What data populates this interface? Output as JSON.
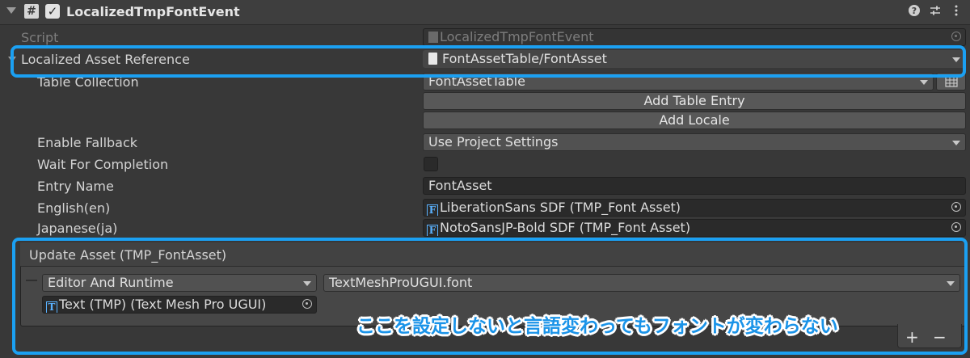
{
  "component": {
    "title": "LocalizedTmpFontEvent",
    "help_icon": "help-icon",
    "settings_icon": "sliders-icon",
    "menu_icon": "kebab-menu-icon"
  },
  "script_row": {
    "label": "Script",
    "value": "LocalizedTmpFontEvent"
  },
  "asset_reference": {
    "label": "Localized Asset Reference",
    "value": "FontAssetTable/FontAsset"
  },
  "table_collection": {
    "label": "Table Collection",
    "value": "FontAssetTable"
  },
  "buttons": {
    "add_table_entry": "Add Table Entry",
    "add_locale": "Add Locale"
  },
  "fields": [
    {
      "label": "Enable Fallback",
      "value": "Use Project Settings"
    },
    {
      "label": "Wait For Completion",
      "value": ""
    },
    {
      "label": "Entry Name",
      "value": "FontAsset"
    },
    {
      "label": "English(en)",
      "value": "LiberationSans SDF (TMP_Font Asset)"
    },
    {
      "label": "Japanese(ja)",
      "value": "NotoSansJP-Bold SDF (TMP_Font Asset)"
    }
  ],
  "event": {
    "title": "Update Asset (TMP_FontAsset)",
    "runtime_mode": "Editor And Runtime",
    "function": "TextMeshProUGUI.font",
    "target": "Text (TMP) (Text Mesh Pro UGUI)",
    "add_label": "+",
    "remove_label": "−"
  },
  "annotation": "ここを設定しないと言語変わってもフォントが変わらない",
  "colors": {
    "highlight": "#1ba0f2",
    "annotation_text": "#1a93e8",
    "object_icon": "#5ab2ff"
  }
}
